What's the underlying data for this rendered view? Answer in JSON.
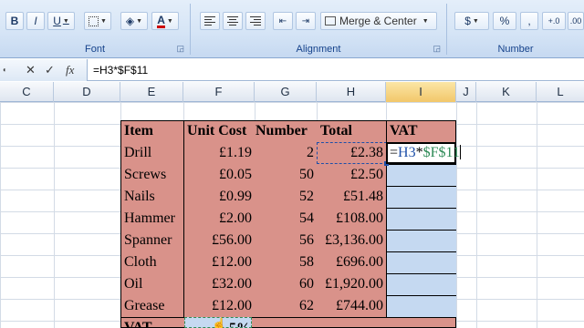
{
  "ribbon": {
    "font_group": {
      "label": "Font",
      "bold": "B",
      "italic": "I",
      "underline": "U"
    },
    "alignment_group": {
      "label": "Alignment",
      "merge_center": "Merge & Center"
    },
    "number_group": {
      "label": "Number",
      "currency": "$",
      "percent": "%",
      "comma": ",",
      "inc_decimal": "+.0",
      "dec_decimal": ".00"
    }
  },
  "formula_bar": {
    "formula": "=H3*$F$11",
    "fx": "fx"
  },
  "columns": [
    "C",
    "D",
    "E",
    "F",
    "G",
    "H",
    "I",
    "J",
    "K",
    "L"
  ],
  "active_column": "I",
  "table": {
    "headers": {
      "item": "Item",
      "unit_cost": "Unit Cost",
      "number": "Number",
      "total": "Total",
      "vat": "VAT"
    },
    "rows": [
      {
        "item": "Drill",
        "unit_cost": "£1.19",
        "number": "2",
        "total": "£2.38"
      },
      {
        "item": "Screws",
        "unit_cost": "£0.05",
        "number": "50",
        "total": "£2.50"
      },
      {
        "item": "Nails",
        "unit_cost": "£0.99",
        "number": "52",
        "total": "£51.48"
      },
      {
        "item": "Hammer",
        "unit_cost": "£2.00",
        "number": "54",
        "total": "£108.00"
      },
      {
        "item": "Spanner",
        "unit_cost": "£56.00",
        "number": "56",
        "total": "£3,136.00"
      },
      {
        "item": "Cloth",
        "unit_cost": "£12.00",
        "number": "58",
        "total": "£696.00"
      },
      {
        "item": "Oil",
        "unit_cost": "£32.00",
        "number": "60",
        "total": "£1,920.00"
      },
      {
        "item": "Grease",
        "unit_cost": "£12.00",
        "number": "62",
        "total": "£744.00"
      }
    ],
    "vat_label": "VAT",
    "vat_rate": "5%"
  },
  "editing": {
    "ref_h3": "H3",
    "op": "*",
    "ref_f11": "$F$11",
    "eq": "="
  }
}
